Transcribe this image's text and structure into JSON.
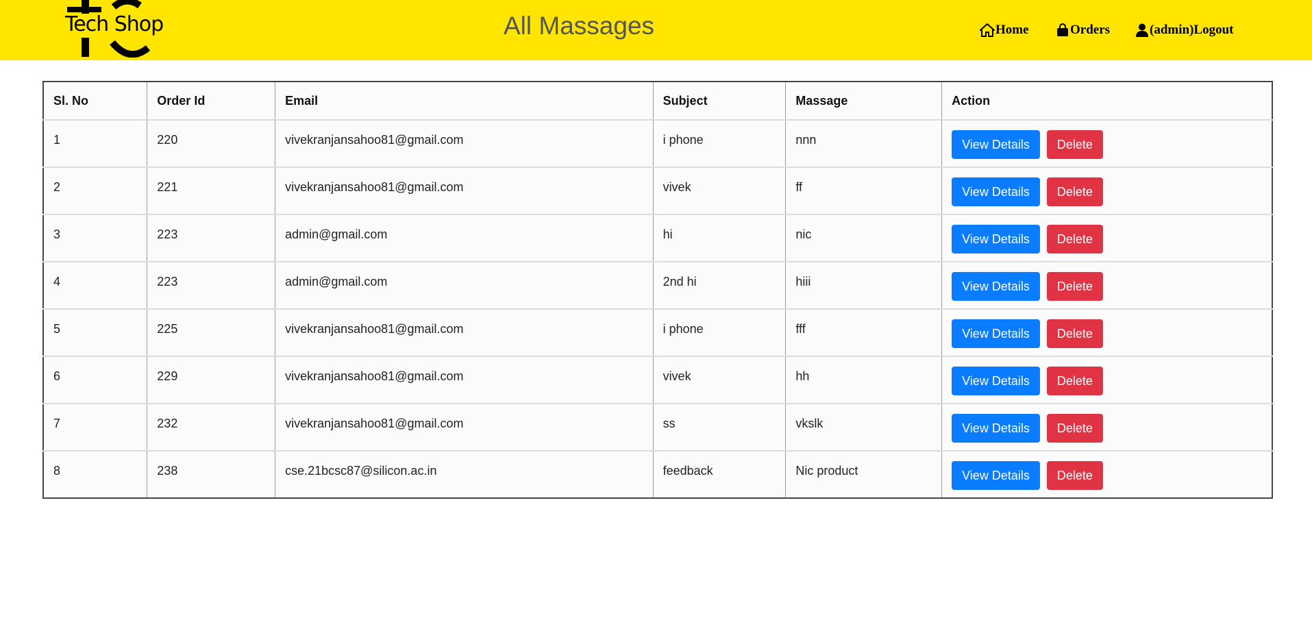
{
  "header": {
    "logo_text": "Tech Shop",
    "title": "All Massages",
    "nav": {
      "home": "Home",
      "orders": "Orders",
      "logout": "(admin)Logout"
    }
  },
  "colors": {
    "header_bg": "#ffe500",
    "view_button": "#0a7cff",
    "delete_button": "#e03445"
  },
  "table": {
    "headers": [
      "Sl. No",
      "Order Id",
      "Email",
      "Subject",
      "Massage",
      "Action"
    ],
    "view_label": "View Details",
    "delete_label": "Delete",
    "rows": [
      {
        "sl": "1",
        "order_id": "220",
        "email": "vivekranjansahoo81@gmail.com",
        "subject": "i phone",
        "message": "nnn"
      },
      {
        "sl": "2",
        "order_id": "221",
        "email": "vivekranjansahoo81@gmail.com",
        "subject": "vivek",
        "message": "ff"
      },
      {
        "sl": "3",
        "order_id": "223",
        "email": "admin@gmail.com",
        "subject": "hi",
        "message": "nic"
      },
      {
        "sl": "4",
        "order_id": "223",
        "email": "admin@gmail.com",
        "subject": "2nd hi",
        "message": "hiii"
      },
      {
        "sl": "5",
        "order_id": "225",
        "email": "vivekranjansahoo81@gmail.com",
        "subject": "i phone",
        "message": "fff"
      },
      {
        "sl": "6",
        "order_id": "229",
        "email": "vivekranjansahoo81@gmail.com",
        "subject": "vivek",
        "message": "hh"
      },
      {
        "sl": "7",
        "order_id": "232",
        "email": "vivekranjansahoo81@gmail.com",
        "subject": "ss",
        "message": "vkslk"
      },
      {
        "sl": "8",
        "order_id": "238",
        "email": "cse.21bcsc87@silicon.ac.in",
        "subject": "feedback",
        "message": "Nic product"
      }
    ]
  }
}
